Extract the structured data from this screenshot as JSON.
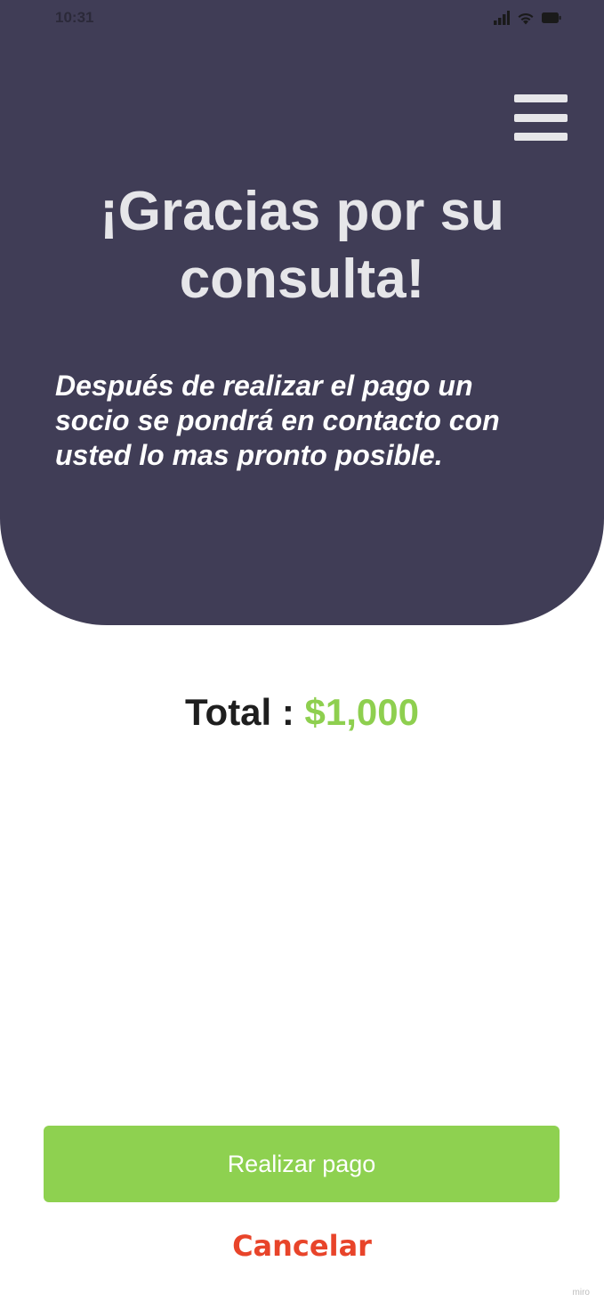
{
  "status_bar": {
    "time": "10:31",
    "icons": [
      "cellular-signal-icon",
      "wifi-icon",
      "battery-icon"
    ]
  },
  "header": {
    "menu_icon": "hamburger-menu-icon",
    "title_line1": "¡Gracias por su",
    "title_line2": "consulta!",
    "message": "Después de realizar el pago un socio se pondrá en contacto con usted lo mas pronto posible."
  },
  "total": {
    "label": "Total : ",
    "amount": "$1,000"
  },
  "actions": {
    "pay_label": "Realizar pago",
    "cancel_label": "Cancelar"
  },
  "watermark": "miro",
  "colors": {
    "header_bg": "#403d56",
    "accent_green": "#8ed150",
    "cancel_red": "#e8442a",
    "title_text": "#e6e6e9"
  }
}
